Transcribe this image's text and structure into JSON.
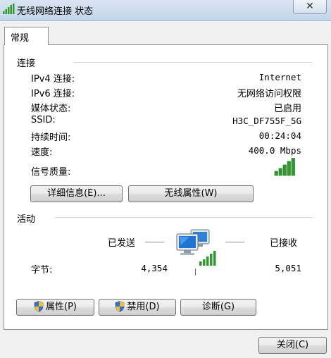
{
  "window": {
    "title": "无线网络连接 状态",
    "close_symbol": "✕"
  },
  "tabs": {
    "general": "常规"
  },
  "connection": {
    "heading": "连接",
    "rows": [
      {
        "label": "IPv4 连接:",
        "value": "Internet"
      },
      {
        "label": "IPv6 连接:",
        "value": "无网络访问权限"
      },
      {
        "label": "媒体状态:",
        "value": "已启用"
      },
      {
        "label": "SSID:",
        "value": "H3C_DF755F_5G"
      },
      {
        "label": "持续时间:",
        "value": "00:24:04"
      },
      {
        "label": "速度:",
        "value": "400.0 Mbps"
      }
    ],
    "signal_label": "信号质量:",
    "signal_bars": 5,
    "details_button": "详细信息(E)...",
    "wireless_props_button": "无线属性(W)"
  },
  "activity": {
    "heading": "活动",
    "sent_label": "已发送",
    "received_label": "已接收",
    "bytes_label": "字节:",
    "bytes_sent": "4,354",
    "bytes_received": "5,051",
    "properties_button": "属性(P)",
    "disable_button": "禁用(D)",
    "diagnose_button": "诊断(G)"
  },
  "footer": {
    "close_button": "关闭(C)"
  },
  "colors": {
    "signal_green": "#2f9a2f",
    "shield_blue": "#3b6fc4",
    "shield_yellow": "#e8c13a"
  },
  "icons": {
    "title": "wireless-signal-icon",
    "activity": "network-computers-icon",
    "shield": "uac-shield-icon"
  }
}
